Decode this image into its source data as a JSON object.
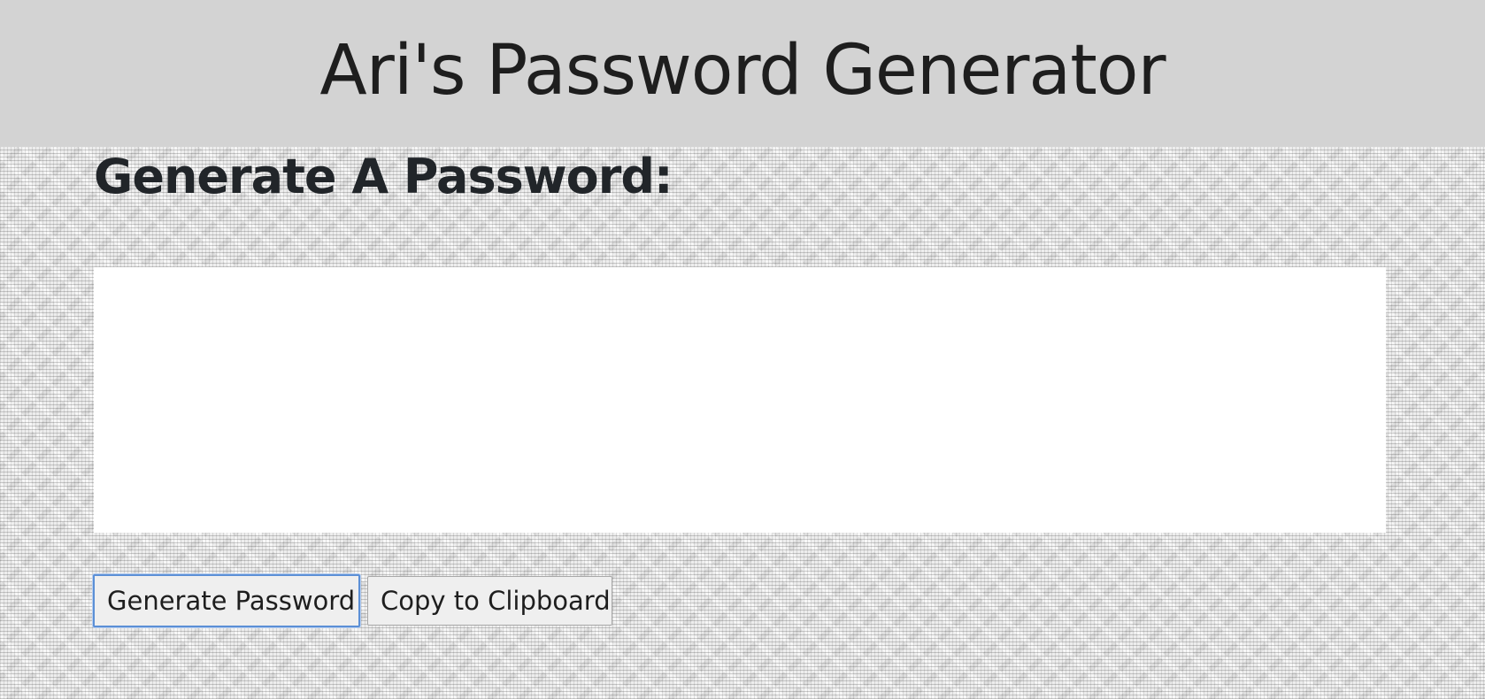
{
  "header": {
    "title": "Ari's Password Generator"
  },
  "main": {
    "heading": "Generate A Password:",
    "password_output": {
      "value": "",
      "placeholder": ""
    },
    "buttons": {
      "generate_label": "Generate Password",
      "copy_label": "Copy to Clipboard"
    }
  },
  "colors": {
    "header_background": "#d3d3d3",
    "focus_ring": "#5b8fd6",
    "output_background": "#ffffff"
  }
}
